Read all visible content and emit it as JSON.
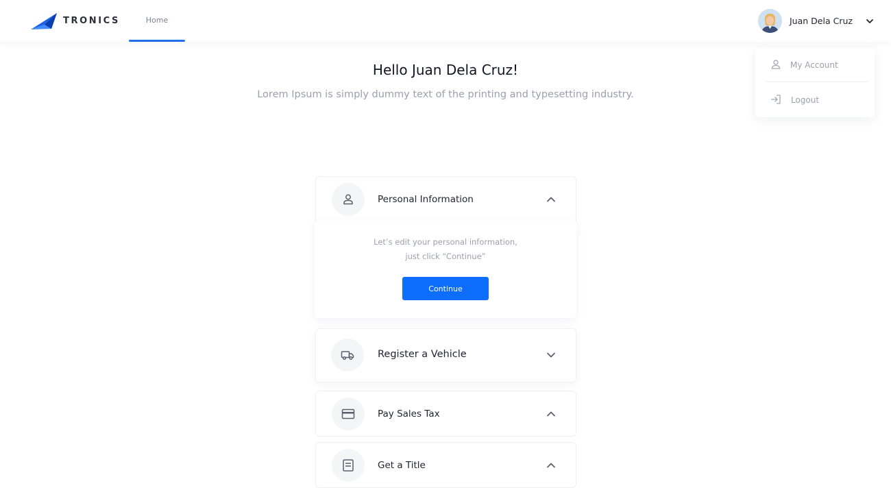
{
  "header": {
    "brand": "TRONICS",
    "nav": {
      "home_label": "Home"
    },
    "user": {
      "name": "Juan Dela Cruz"
    }
  },
  "user_dropdown": {
    "items": [
      {
        "label": "My Account",
        "icon": "user-icon"
      },
      {
        "label": "Logout",
        "icon": "logout-icon"
      }
    ]
  },
  "hero": {
    "greeting": "Hello Juan Dela Cruz!",
    "subtitle": "Lorem Ipsum is simply dummy text of the printing and typesetting industry."
  },
  "sections": [
    {
      "title": "Personal Information",
      "icon": "person-icon",
      "expanded": true,
      "panel_line1": "Let’s edit your personal information,",
      "panel_line2": "just click “Continue”",
      "button_label": "Continue"
    },
    {
      "title": "Register a Vehicle",
      "icon": "truck-icon",
      "expanded": false
    },
    {
      "title": "Pay Sales Tax",
      "icon": "credit-card-icon",
      "expanded": true
    },
    {
      "title": "Get a Title",
      "icon": "document-icon",
      "expanded": true
    }
  ],
  "colors": {
    "accent": "#0d6efd",
    "nav_underline": "#1f6fec",
    "muted_text": "#9aa0ad"
  }
}
